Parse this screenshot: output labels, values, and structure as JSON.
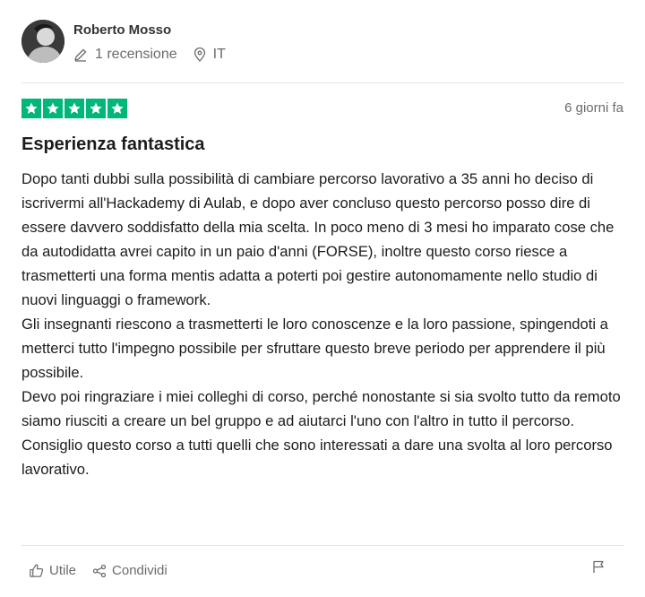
{
  "reviewer": {
    "name": "Roberto Mosso",
    "avatar_icon": "user-avatar",
    "reviews_icon": "pencil-icon",
    "reviews_count": "1 recensione",
    "location_icon": "location-pin-icon",
    "country": "IT"
  },
  "review": {
    "rating": 5,
    "rating_max": 5,
    "star_color": "#00b67a",
    "date": "6 giorni fa",
    "title": "Esperienza fantastica",
    "paragraphs": [
      "Dopo tanti dubbi sulla possibilità di cambiare percorso lavorativo a 35 anni ho deciso di iscrivermi all'Hackademy di Aulab, e dopo aver concluso questo percorso posso dire di essere davvero soddisfatto della mia scelta. In poco meno di 3 mesi ho imparato cose che da autodidatta avrei capito in un paio d'anni (FORSE), inoltre questo corso riesce a trasmetterti una forma mentis adatta a poterti poi gestire autonomamente nello studio di nuovi linguaggi o framework.",
      "Gli insegnanti riescono a trasmetterti le loro conoscenze e la loro passione, spingendoti a metterci tutto l'impegno possibile per sfruttare questo breve periodo per apprendere il più possibile.",
      "Devo poi ringraziare i miei colleghi di corso, perché nonostante si sia svolto tutto da remoto siamo riusciti a creare un bel gruppo e ad aiutarci l'uno con l'altro in tutto il percorso.",
      "Consiglio questo corso a tutti quelli che sono interessati a dare una svolta al loro percorso lavorativo."
    ]
  },
  "actions": {
    "useful_icon": "thumbs-up-icon",
    "useful_label": "Utile",
    "share_icon": "share-icon",
    "share_label": "Condividi",
    "report_icon": "flag-icon"
  }
}
